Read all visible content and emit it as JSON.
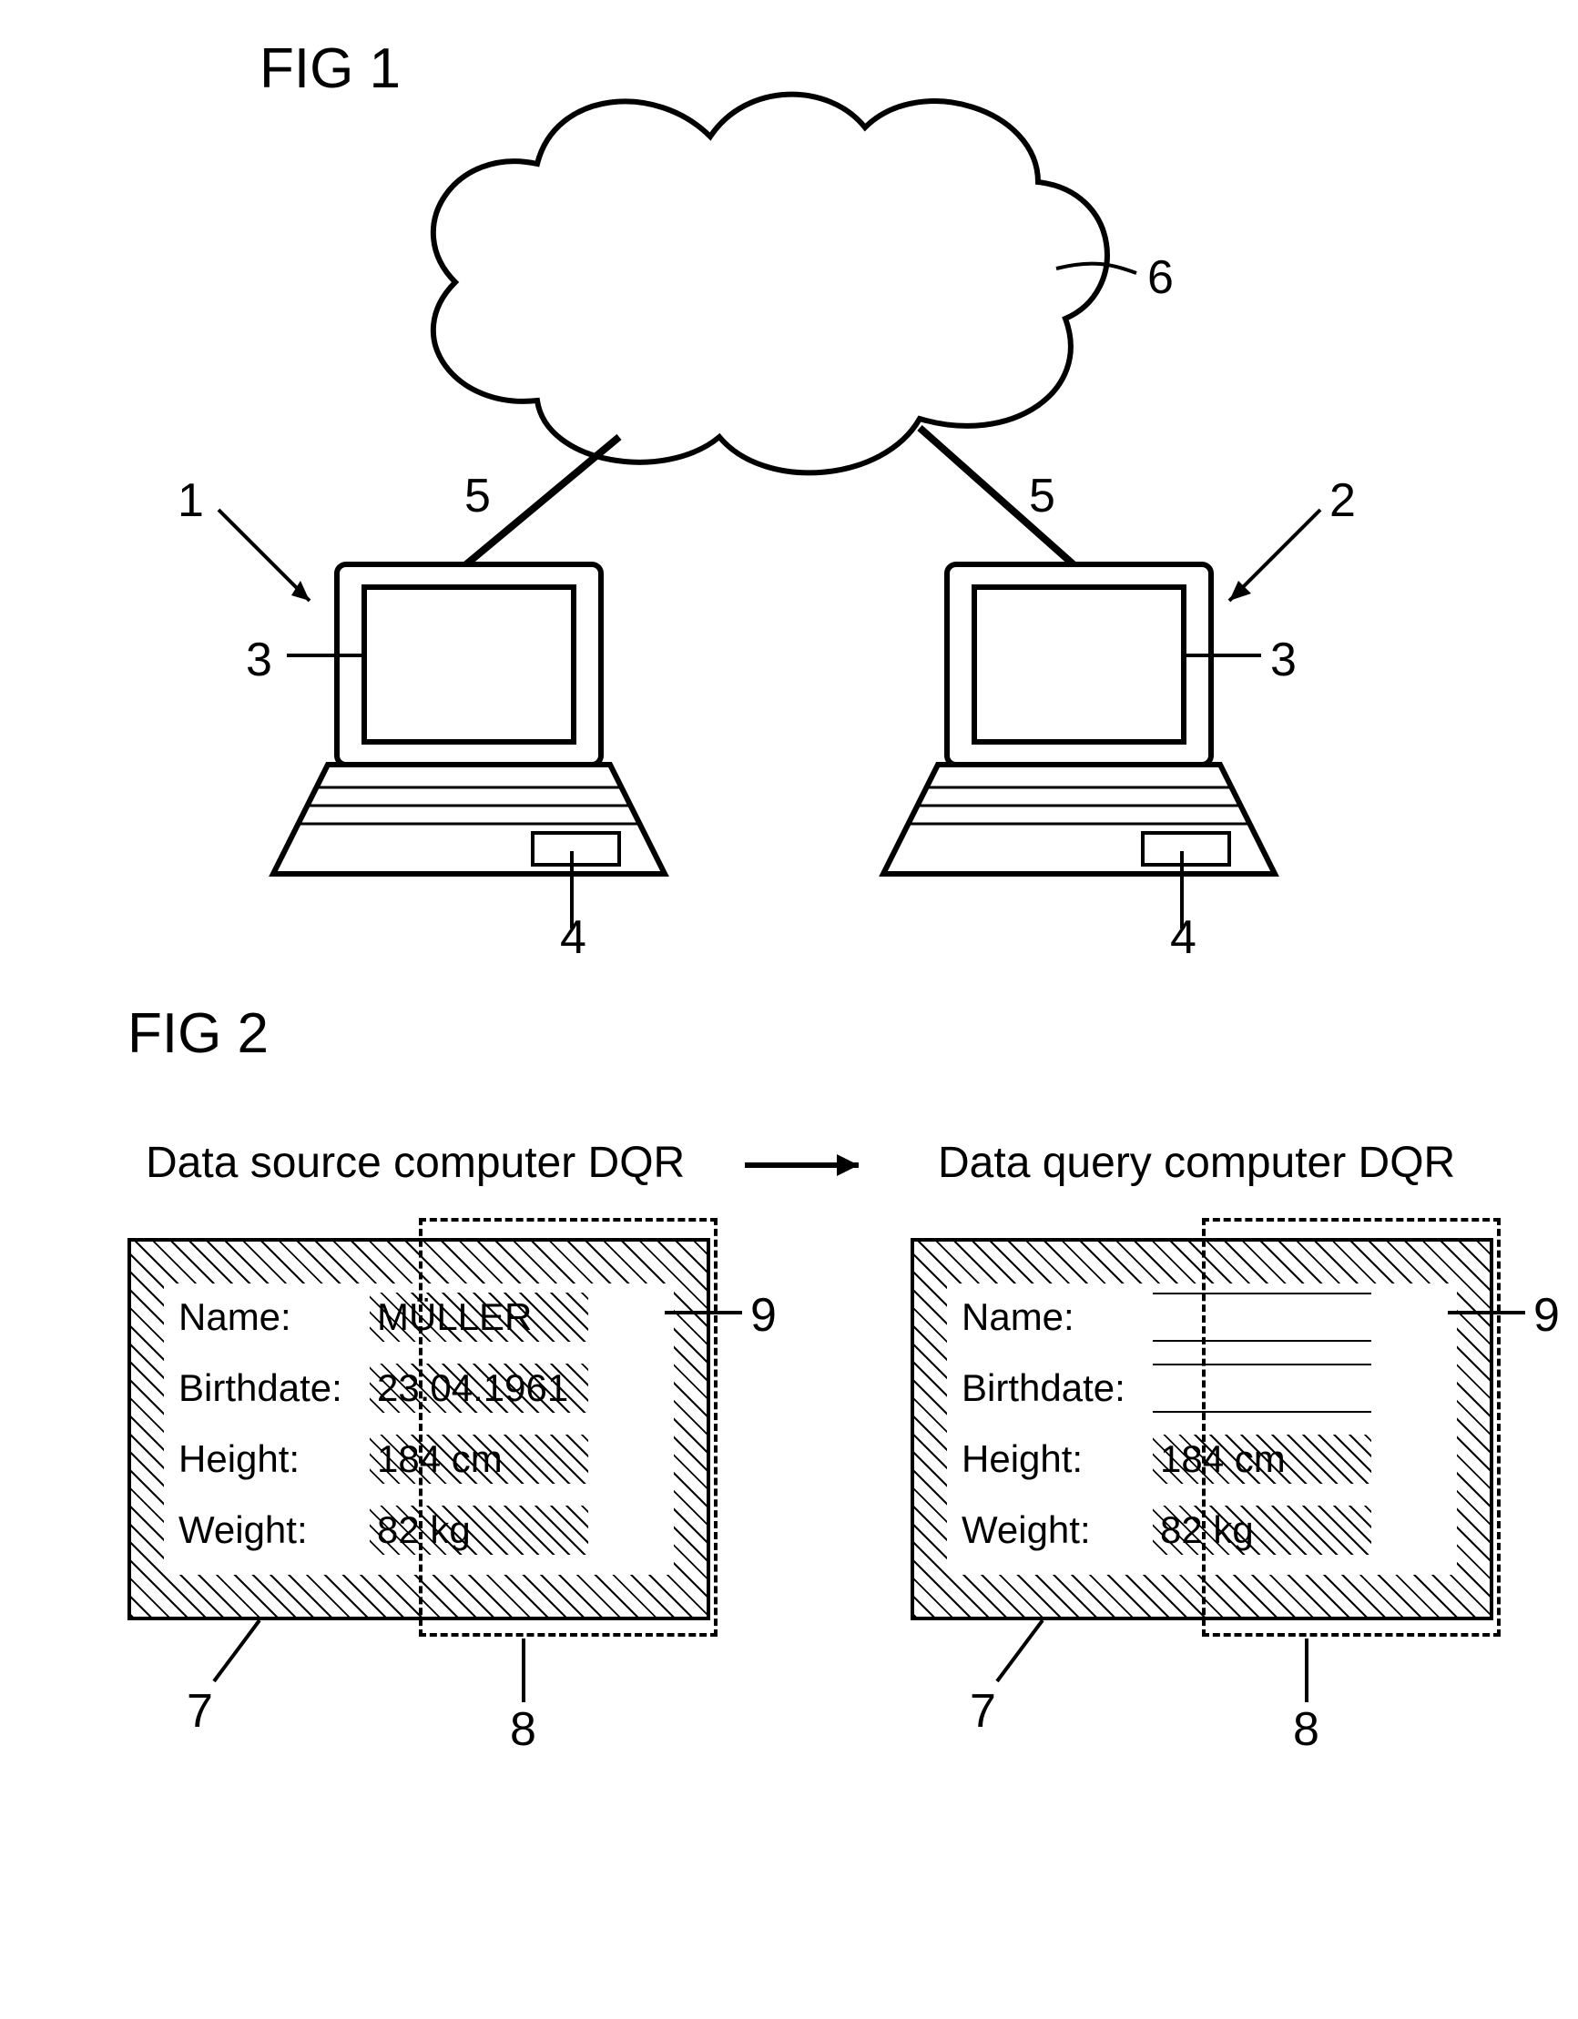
{
  "fig1": {
    "title": "FIG 1",
    "labels": {
      "l1": "1",
      "l2": "2",
      "l3a": "3",
      "l3b": "3",
      "l4a": "4",
      "l4b": "4",
      "l5a": "5",
      "l5b": "5",
      "l6": "6"
    }
  },
  "fig2": {
    "title": "FIG 2",
    "caption_left": "Data source computer DQR",
    "caption_right": "Data query computer DQR",
    "left_box": {
      "rows": [
        {
          "label": "Name:",
          "value": "MÜLLER"
        },
        {
          "label": "Birthdate:",
          "value": "23.04.1961"
        },
        {
          "label": "Height:",
          "value": "184 cm"
        },
        {
          "label": "Weight:",
          "value": "82 kg"
        }
      ]
    },
    "right_box": {
      "rows": [
        {
          "label": "Name:",
          "value": ""
        },
        {
          "label": "Birthdate:",
          "value": ""
        },
        {
          "label": "Height:",
          "value": "184 cm"
        },
        {
          "label": "Weight:",
          "value": "82 kg"
        }
      ]
    },
    "labels": {
      "l7a": "7",
      "l7b": "7",
      "l8a": "8",
      "l8b": "8",
      "l9a": "9",
      "l9b": "9"
    }
  }
}
